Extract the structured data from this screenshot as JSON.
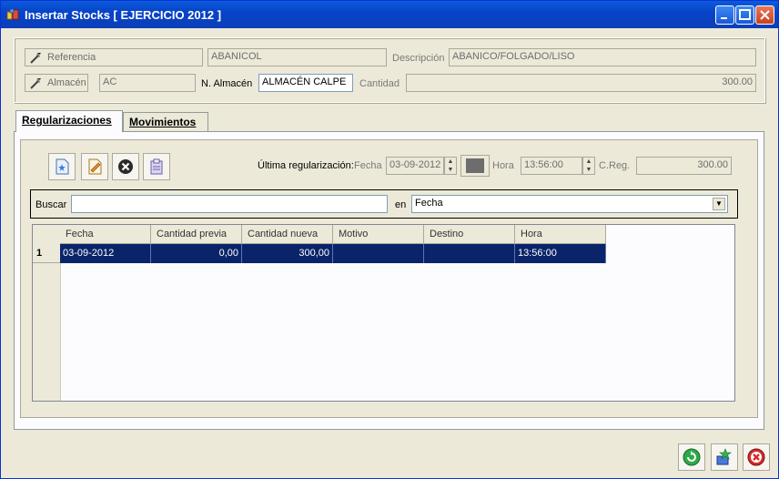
{
  "window": {
    "title": "Insertar Stocks [ EJERCICIO 2012 ]"
  },
  "header": {
    "referencia_label": "Referencia",
    "referencia_value": "ABANICOL",
    "descripcion_label": "Descripción",
    "descripcion_value": "ABANICO/FOLGADO/LISO",
    "almacen_label": "Almacén",
    "almacen_value": "AC",
    "n_almacen_label": "N. Almacén",
    "n_almacen_value": "ALMACÉN CALPE",
    "cantidad_label": "Cantidad",
    "cantidad_value": "300.00"
  },
  "tabs": [
    {
      "label": "Regularizaciones",
      "active": true
    },
    {
      "label": "Movimientos",
      "active": false
    }
  ],
  "toolbar": {
    "icons": [
      "new-document-icon",
      "edit-document-icon",
      "delete-icon",
      "clipboard-icon"
    ]
  },
  "last_reg": {
    "label": "Última regularización:",
    "fecha_label": "Fecha",
    "fecha_value": "03-09-2012",
    "hora_label": "Hora",
    "hora_value": "13:56:00",
    "creg_label": "C.Reg.",
    "creg_value": "300.00"
  },
  "search": {
    "label": "Buscar",
    "value": "",
    "en_label": "en",
    "field_selected": "Fecha"
  },
  "grid": {
    "columns": [
      "Fecha",
      "Cantidad previa",
      "Cantidad nueva",
      "Motivo",
      "Destino",
      "Hora"
    ],
    "rows": [
      {
        "num": "1",
        "cells": [
          "03-09-2012",
          "0,00",
          "300,00",
          "",
          "",
          "13:56:00"
        ]
      }
    ]
  },
  "colors": {
    "titlebar": "#0843c8",
    "selection": "#0a246a",
    "window_bg": "#ece9d8"
  }
}
